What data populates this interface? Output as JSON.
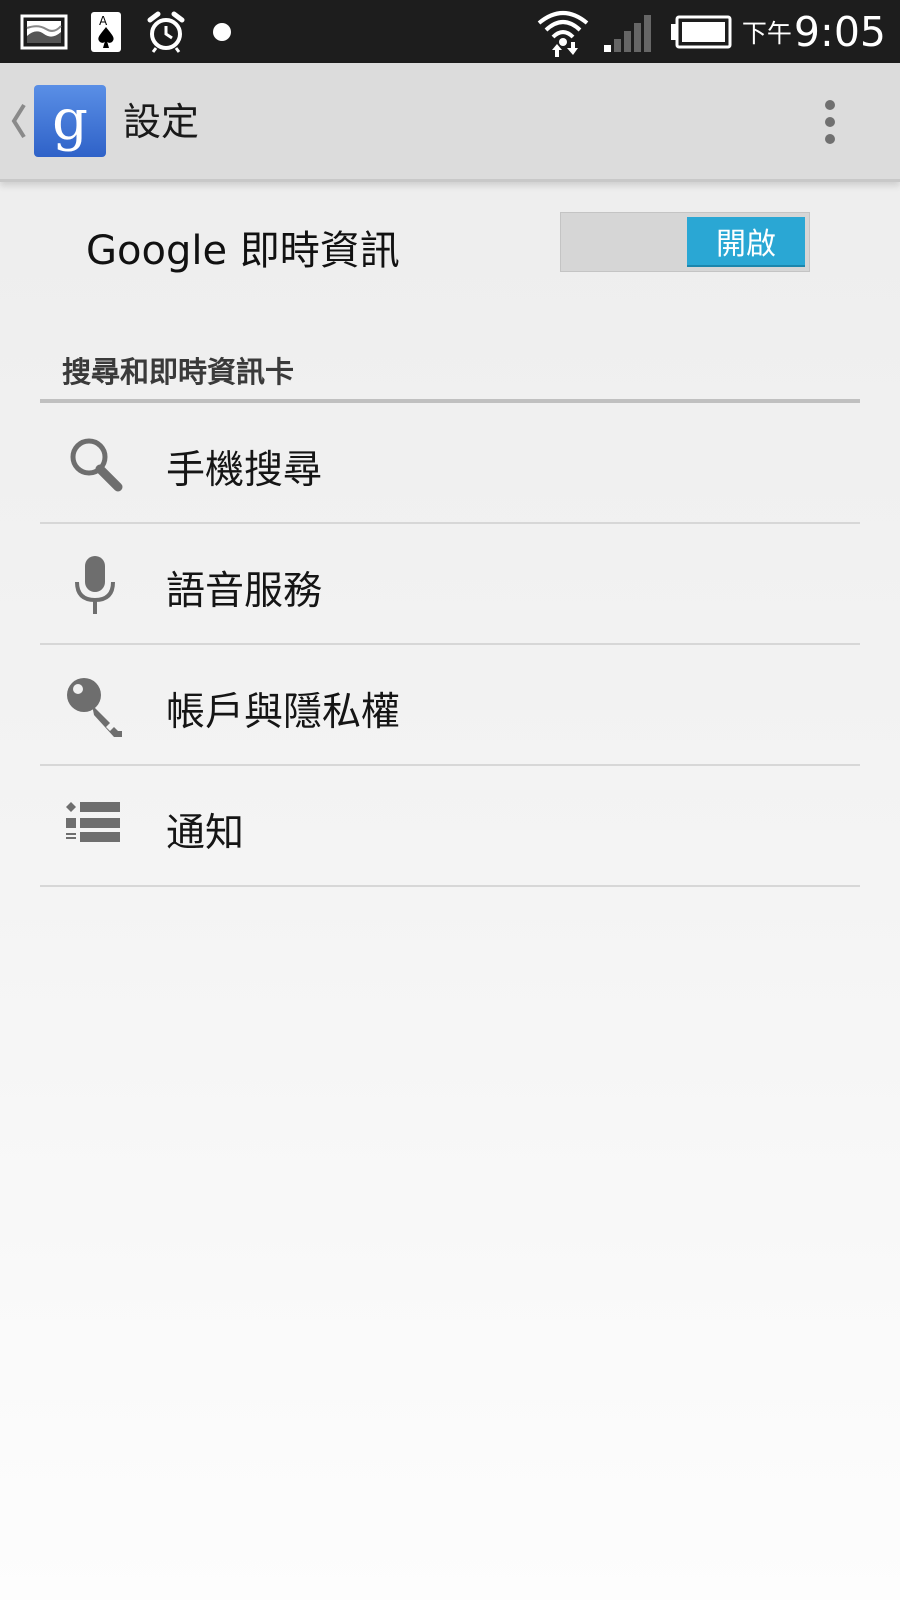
{
  "status_bar": {
    "clock_ampm": "下午",
    "clock_time": "9:05",
    "left_icons": [
      "gallery-notification-icon",
      "solitaire-notification-icon",
      "alarm-icon",
      "dot-notification-icon"
    ],
    "right_icons": [
      "wifi-icon",
      "signal-icon",
      "battery-icon"
    ]
  },
  "action_bar": {
    "title": "設定",
    "app_icon_glyph": "g",
    "app_icon_color": "#3b74dc"
  },
  "google_now": {
    "label": "Google 即時資訊",
    "toggle_state_label": "開啟",
    "toggle_on": true,
    "toggle_color": "#2aa7d4"
  },
  "section": {
    "title": "搜尋和即時資訊卡"
  },
  "list_items": [
    {
      "label": "手機搜尋",
      "icon": "search-icon"
    },
    {
      "label": "語音服務",
      "icon": "microphone-icon"
    },
    {
      "label": "帳戶與隱私權",
      "icon": "key-icon"
    },
    {
      "label": "通知",
      "icon": "list-icon"
    }
  ]
}
